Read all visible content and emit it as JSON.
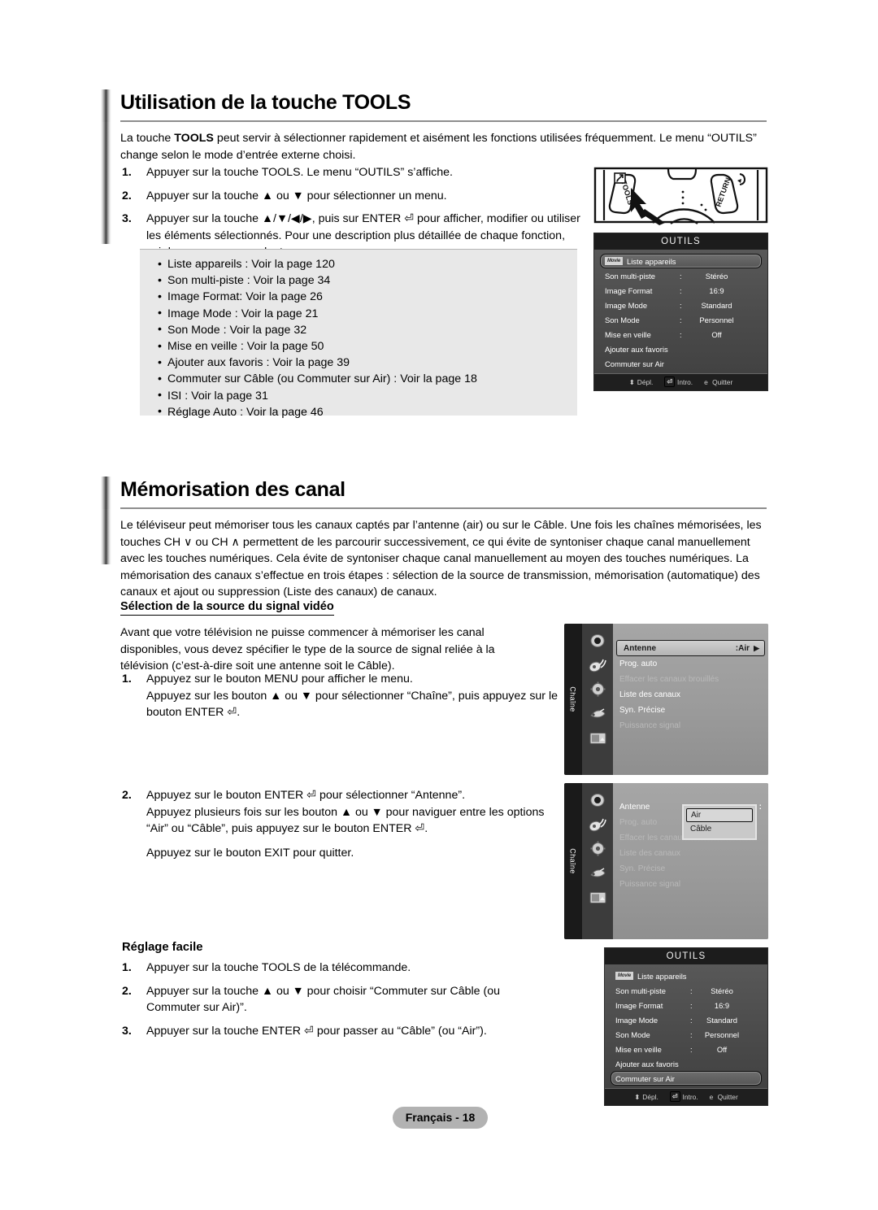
{
  "section1": {
    "title": "Utilisation de la touche TOOLS",
    "intro_a": "La touche ",
    "intro_b": "TOOLS",
    "intro_c": " peut servir à sélectionner rapidement et aisément les fonctions utilisées fréquemment. Le menu “OUTILS” change selon le mode d’entrée externe choisi.",
    "steps": [
      {
        "num": "1.",
        "text": "Appuyer sur la touche TOOLS. Le menu “OUTILS” s’affiche."
      },
      {
        "num": "2.",
        "text": "Appuyer sur la touche ▲ ou ▼ pour sélectionner un menu."
      },
      {
        "num": "3.",
        "text": "Appuyer sur la touche ▲/▼/◀/▶, puis sur ENTER ⏎ pour afficher, modifier ou utiliser les éléments sélectionnés. Pour une description plus détaillée de chaque fonction, voir la page correspondante."
      }
    ],
    "bullets": [
      "Liste appareils : Voir la page 120",
      "Son multi-piste : Voir la page 34",
      "Image Format: Voir la page 26",
      "Image Mode : Voir la page 21",
      "Son Mode : Voir la page 32",
      "Mise en veille : Voir la page 50",
      "Ajouter aux favoris : Voir la page 39",
      "Commuter sur Câble (ou Commuter sur Air) : Voir la page 18",
      "ISI : Voir la page 31",
      "Réglage Auto : Voir la page 46"
    ]
  },
  "remote": {
    "tools_label": "TOOLS",
    "return_label": "RETURN"
  },
  "osd_tools_top": {
    "title": "OUTILS",
    "rows": [
      {
        "badge": "Movie",
        "label": "Liste appareils",
        "colon": "",
        "value": "",
        "selected": true
      },
      {
        "badge": "",
        "label": "Son multi-piste",
        "colon": ":",
        "value": "Stéréo",
        "selected": false
      },
      {
        "badge": "",
        "label": "Image Format",
        "colon": ":",
        "value": "16:9",
        "selected": false
      },
      {
        "badge": "",
        "label": "Image Mode",
        "colon": ":",
        "value": "Standard",
        "selected": false
      },
      {
        "badge": "",
        "label": "Son Mode",
        "colon": ":",
        "value": "Personnel",
        "selected": false
      },
      {
        "badge": "",
        "label": "Mise en veille",
        "colon": ":",
        "value": "Off",
        "selected": false
      },
      {
        "badge": "",
        "label": "Ajouter aux favoris",
        "colon": "",
        "value": "",
        "selected": false
      },
      {
        "badge": "",
        "label": "Commuter sur Air",
        "colon": "",
        "value": "",
        "selected": false
      }
    ],
    "footer": [
      {
        "key": "⬍",
        "label": "Dépl."
      },
      {
        "key": "⏎",
        "label": "Intro."
      },
      {
        "key": "e",
        "label": "Quitter"
      }
    ]
  },
  "section2": {
    "title": "Mémorisation des canal",
    "intro": "Le téléviseur peut mémoriser tous les canaux captés par l’antenne (air) ou sur le Câble. Une fois les chaînes mémorisées, les touches CH ∨ ou CH ∧ permettent de les parcourir successivement, ce qui évite de syntoniser chaque canal manuellement avec les touches numériques. Cela évite de syntoniser chaque canal manuellement au moyen des touches numériques. La mémorisation des canaux s’effectue en trois étapes : sélection de la source de transmission, mémorisation (automatique) des canaux et ajout ou suppression (Liste des canaux) de canaux.",
    "subhead": "Sélection de la source du signal vidéo",
    "para": "Avant que votre télévision ne puisse commencer à mémoriser les canal disponibles, vous devez spécifier le type de la source de signal reliée à la télévision (c’est-à-dire soit une antenne soit le Câble).",
    "step1": {
      "num": "1.",
      "line1": "Appuyez sur le bouton MENU pour afficher le menu.",
      "line2": "Appuyez sur les bouton ▲ ou ▼ pour sélectionner “Chaîne”, puis appuyez sur le bouton ENTER ⏎."
    },
    "step2": {
      "num": "2.",
      "line1": "Appuyez sur le bouton ENTER ⏎ pour sélectionner “Antenne”.",
      "line2": "Appuyez plusieurs fois sur les bouton ▲ ou ▼ pour naviguer entre les options “Air” ou “Câble”, puis appuyez sur le bouton ENTER ⏎.",
      "line3": "Appuyez sur le bouton EXIT pour quitter."
    }
  },
  "osd_channel_1": {
    "tab": "Chaîne",
    "items": [
      {
        "label": "Antenne",
        "value": ":Air",
        "state": "selected",
        "arrow": "▶"
      },
      {
        "label": "Prog. auto",
        "value": "",
        "state": "normal",
        "arrow": ""
      },
      {
        "label": "Effacer les canaux brouillés",
        "value": "",
        "state": "dim",
        "arrow": ""
      },
      {
        "label": "Liste des canaux",
        "value": "",
        "state": "normal",
        "arrow": ""
      },
      {
        "label": "Syn. Précise",
        "value": "",
        "state": "normal",
        "arrow": ""
      },
      {
        "label": "Puissance signal",
        "value": "",
        "state": "dim",
        "arrow": ""
      }
    ],
    "icons": [
      "input-icon",
      "antenna-icon",
      "gear-icon",
      "sound-icon",
      "picture-icon"
    ]
  },
  "osd_channel_2": {
    "tab": "Chaîne",
    "items": [
      {
        "label": "Antenne",
        "value": ":",
        "state": "normal",
        "arrow": ""
      },
      {
        "label": "Prog. auto",
        "value": "",
        "state": "dim",
        "arrow": ""
      },
      {
        "label": "Effacer les canaux brouillés",
        "value": "",
        "state": "dim",
        "arrow": ""
      },
      {
        "label": "Liste des canaux",
        "value": "",
        "state": "dim",
        "arrow": ""
      },
      {
        "label": "Syn. Précise",
        "value": "",
        "state": "dim",
        "arrow": ""
      },
      {
        "label": "Puissance signal",
        "value": "",
        "state": "dim",
        "arrow": ""
      }
    ],
    "dropdown": [
      {
        "label": "Air",
        "selected": true
      },
      {
        "label": "Câble",
        "selected": false
      }
    ]
  },
  "section3": {
    "subhead": "Réglage facile",
    "steps": [
      {
        "num": "1.",
        "text": "Appuyer sur la touche TOOLS de la télécommande."
      },
      {
        "num": "2.",
        "text": "Appuyer sur la touche ▲ ou ▼ pour choisir “Commuter sur Câble (ou Commuter sur Air)”."
      },
      {
        "num": "3.",
        "text": "Appuyer sur la touche ENTER ⏎ pour passer au “Câble” (ou “Air”)."
      }
    ]
  },
  "osd_tools_bottom": {
    "title": "OUTILS",
    "rows": [
      {
        "badge": "Movie",
        "label": "Liste appareils",
        "colon": "",
        "value": "",
        "selected": false
      },
      {
        "badge": "",
        "label": "Son multi-piste",
        "colon": ":",
        "value": "Stéréo",
        "selected": false
      },
      {
        "badge": "",
        "label": "Image Format",
        "colon": ":",
        "value": "16:9",
        "selected": false
      },
      {
        "badge": "",
        "label": "Image Mode",
        "colon": ":",
        "value": "Standard",
        "selected": false
      },
      {
        "badge": "",
        "label": "Son Mode",
        "colon": ":",
        "value": "Personnel",
        "selected": false
      },
      {
        "badge": "",
        "label": "Mise en veille",
        "colon": ":",
        "value": "Off",
        "selected": false
      },
      {
        "badge": "",
        "label": "Ajouter aux favoris",
        "colon": "",
        "value": "",
        "selected": false
      },
      {
        "badge": "",
        "label": "Commuter sur Air",
        "colon": "",
        "value": "",
        "selected": true
      }
    ],
    "footer": [
      {
        "key": "⬍",
        "label": "Dépl."
      },
      {
        "key": "⏎",
        "label": "Intro."
      },
      {
        "key": "e",
        "label": "Quitter"
      }
    ]
  },
  "footer": {
    "label": "Français - 18"
  }
}
